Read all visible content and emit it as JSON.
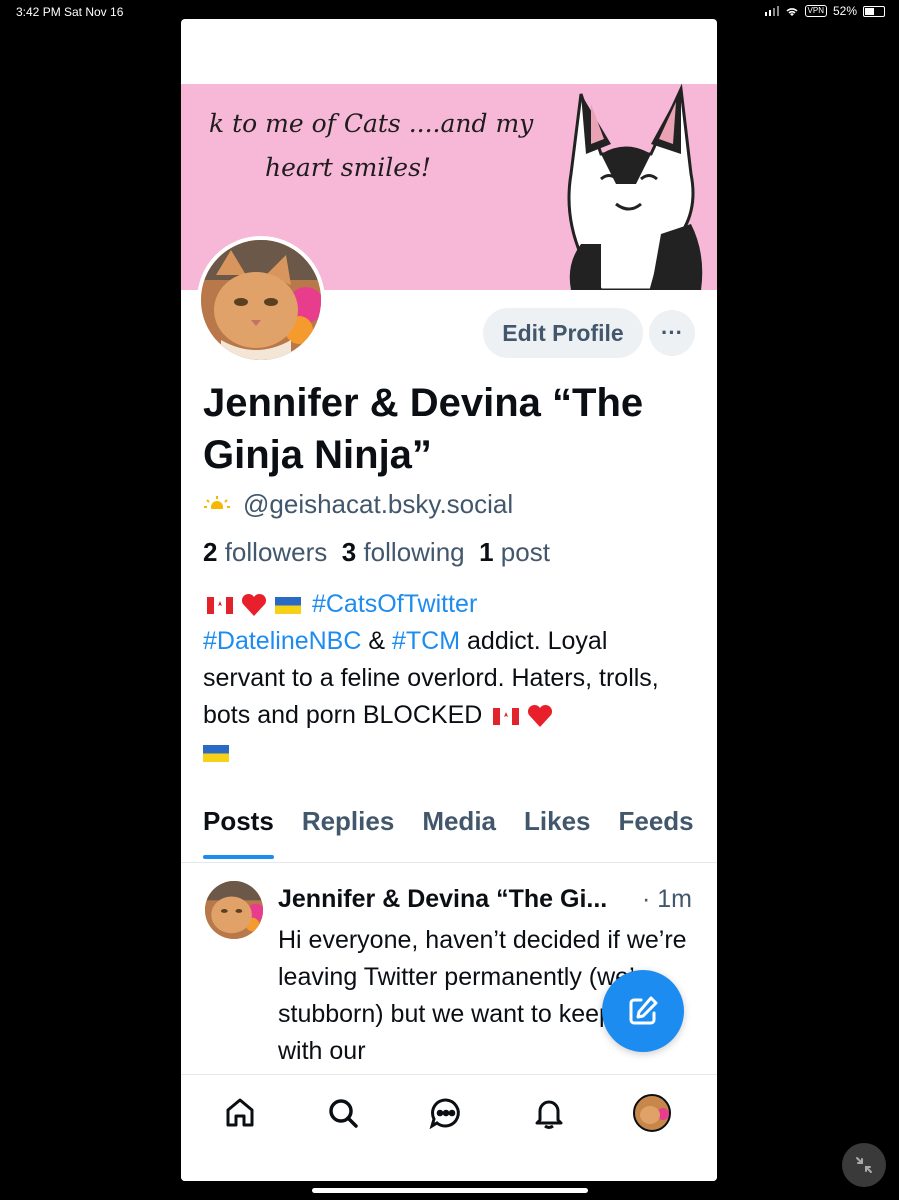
{
  "status_bar": {
    "time": "3:42 PM",
    "date": "Sat Nov 16",
    "vpn": "VPN",
    "battery": "52%"
  },
  "banner": {
    "line1": "k to me of Cats ....and my",
    "line2": "heart smiles!"
  },
  "profile": {
    "edit_label": "Edit Profile",
    "more_label": "···",
    "name": "Jennifer & Devina “The Ginja Ninja”",
    "handle": "@geishacat.bsky.social",
    "followers_count": "2",
    "followers_label": "followers",
    "following_count": "3",
    "following_label": "following",
    "posts_count": "1",
    "posts_label": "post",
    "bio": {
      "tag1": "#CatsOfTwitter",
      "tag2": "#DatelineNBC",
      "amp": " & ",
      "tag3": "#TCM",
      "text": " addict. Loyal servant to a feline overlord. Haters, trolls, bots and porn BLOCKED "
    }
  },
  "tabs": [
    "Posts",
    "Replies",
    "Media",
    "Likes",
    "Feeds"
  ],
  "post": {
    "author": "Jennifer & Devina “The Gi...",
    "time": "· 1m",
    "text": "Hi everyone, haven’t decided if we’re leaving Twitter permanently (we’re stubborn) but we want to keep up with our"
  },
  "nav": [
    "home-icon",
    "search-icon",
    "chat-icon",
    "bell-icon",
    "profile-avatar"
  ],
  "colors": {
    "accent": "#1d8cf0",
    "banner": "#f7b7d6",
    "muted": "#42576c"
  }
}
